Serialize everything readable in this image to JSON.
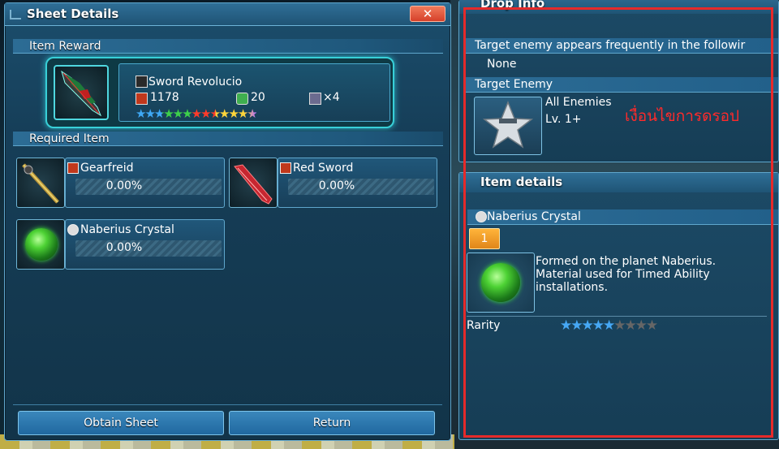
{
  "left_window": {
    "title": "Sheet Details",
    "close_label": "✕",
    "item_reward_header": "Item Reward",
    "reward": {
      "name": "Sword Revolucio",
      "attack": "1178",
      "element": "20",
      "slots": "×4",
      "stars": "★★★★★★★★★★★★★"
    },
    "required_header": "Required Item",
    "required_items": [
      {
        "name": "Gearfreid",
        "percent": "0.00%"
      },
      {
        "name": "Red Sword",
        "percent": "0.00%"
      },
      {
        "name": "Naberius Crystal",
        "percent": "0.00%"
      }
    ],
    "buttons": {
      "obtain": "Obtain Sheet",
      "return": "Return"
    }
  },
  "drop_info": {
    "title": "Drop Info",
    "frequent_header": "Target enemy appears frequently in the followir",
    "frequent_value": "None",
    "target_header": "Target Enemy",
    "enemy_name": "All Enemies",
    "enemy_level": "Lv. 1+",
    "note_thai": "เงื่อนไขการดรอป"
  },
  "item_details": {
    "title": "Item details",
    "name": "Naberius Crystal",
    "count": "1",
    "description_1": "Formed on the planet Naberius.",
    "description_2": "Material used for Timed Ability",
    "description_3": "installations.",
    "rarity_label": "Rarity",
    "rarity_stars_filled": "★★★★★",
    "rarity_stars_empty": "★★★★",
    "rarity_value": 5
  },
  "colors": {
    "annotation": "#e52a2a",
    "accent": "#38d0d8"
  }
}
